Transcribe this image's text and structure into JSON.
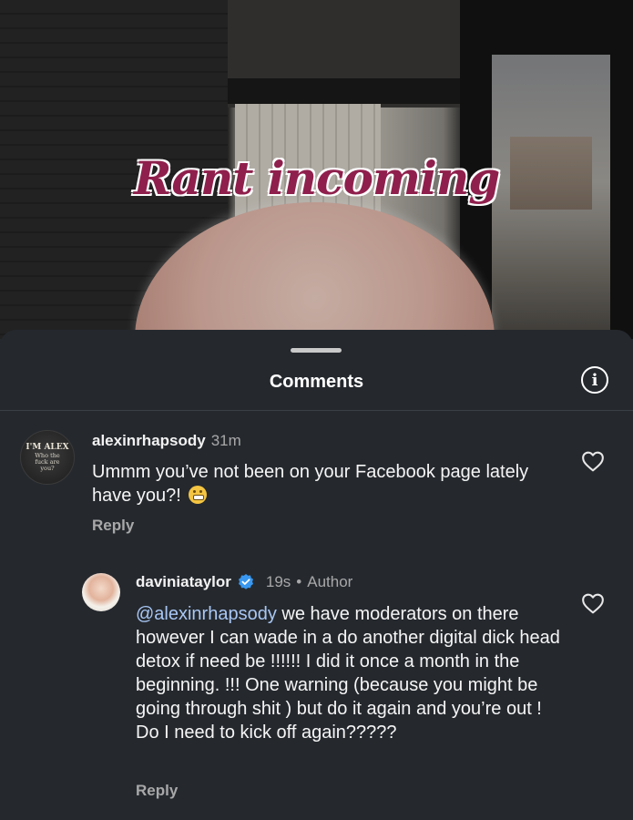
{
  "video": {
    "caption": "Rant incoming"
  },
  "sheet": {
    "title": "Comments",
    "info_icon": "info-icon"
  },
  "comments": [
    {
      "username": "alexinrhapsody",
      "time": "31m",
      "avatar_text_main": "I'M ALEX",
      "avatar_text_sub": "Who the fuck are you?",
      "text": "Ummm you’ve not been on your Facebook page lately have you?!",
      "emoji": "grimacing-face-emoji",
      "reply_label": "Reply",
      "like_icon": "heart-icon"
    },
    {
      "username": "daviniataylor",
      "verified": true,
      "time": "19s",
      "separator": "•",
      "role": "Author",
      "mention": "@alexinrhapsody",
      "text": " we have moderators on there however I can wade in a do another digital dick head detox if need be !!!!!! I did it once a month in the beginning. !!! One warning (because you might be going through shit ) but do it again and you’re out ! Do I need to kick off again?????",
      "reply_label": "Reply",
      "like_icon": "heart-icon"
    }
  ],
  "colors": {
    "sheet_bg": "#25292e",
    "caption": "#8f1f4c",
    "mention": "#a9c7f5",
    "verified": "#3897f0"
  }
}
